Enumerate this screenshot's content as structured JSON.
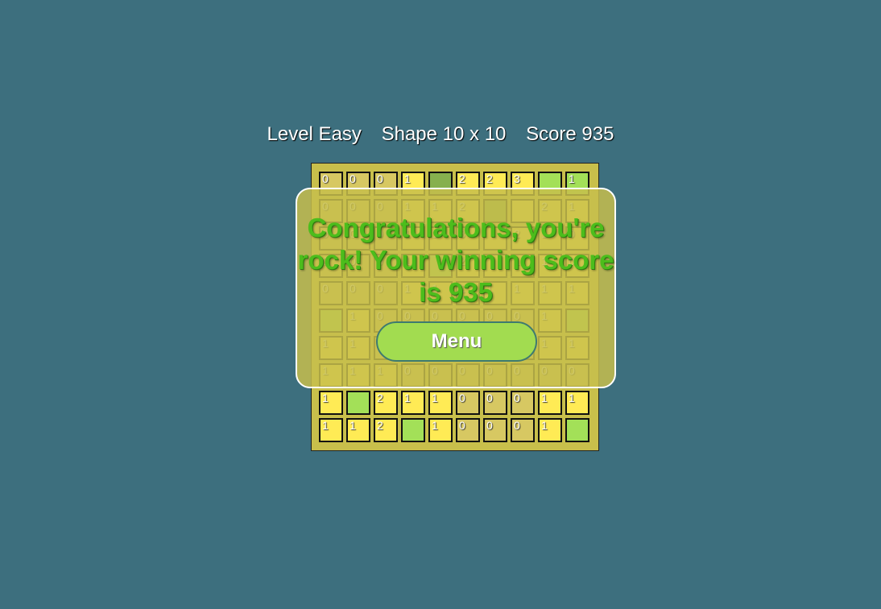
{
  "status": {
    "level": "Level Easy",
    "shape": "Shape 10 x 10",
    "score": "Score 935"
  },
  "colors": {
    "background": "#3d6f7e",
    "board": "#c8bf4b",
    "cell_yellow": "#ffeb55",
    "cell_tan": "#d7c862",
    "cell_green": "#a3e058",
    "cell_dark_green": "#86b04e",
    "message_green": "#4cbd1c"
  },
  "board": {
    "rows": 10,
    "cols": 10,
    "cells": [
      [
        [
          "t",
          "0"
        ],
        [
          "t",
          "0"
        ],
        [
          "t",
          "0"
        ],
        [
          "y",
          "1"
        ],
        [
          "d",
          ""
        ],
        [
          "y",
          "2"
        ],
        [
          "y",
          "2"
        ],
        [
          "y",
          "3"
        ],
        [
          "g",
          ""
        ],
        [
          "g",
          "1"
        ]
      ],
      [
        [
          "t",
          "0"
        ],
        [
          "t",
          "0"
        ],
        [
          "t",
          "0"
        ],
        [
          "y",
          "1"
        ],
        [
          "y",
          "1"
        ],
        [
          "y",
          "2"
        ],
        [
          "d",
          ""
        ],
        [
          "y",
          ""
        ],
        [
          "y",
          "2"
        ],
        [
          "y",
          "1"
        ]
      ],
      [
        [
          "t",
          "0"
        ],
        [
          "t",
          "0"
        ],
        [
          "t",
          "0"
        ],
        [
          "y",
          "1"
        ],
        [
          "y",
          "1"
        ],
        [
          "y",
          "3"
        ],
        [
          "y",
          ""
        ],
        [
          "y",
          "2"
        ],
        [
          "y",
          "1"
        ],
        [
          "y",
          "0"
        ]
      ],
      [
        [
          "t",
          "0"
        ],
        [
          "t",
          "0"
        ],
        [
          "t",
          "0"
        ],
        [
          "y",
          "1"
        ],
        [
          "g",
          ""
        ],
        [
          "y",
          "2"
        ],
        [
          "y",
          ""
        ],
        [
          "y",
          "1"
        ],
        [
          "y",
          "1"
        ],
        [
          "y",
          "0"
        ]
      ],
      [
        [
          "t",
          "0"
        ],
        [
          "t",
          "0"
        ],
        [
          "t",
          "0"
        ],
        [
          "y",
          "1"
        ],
        [
          "y",
          "1"
        ],
        [
          "y",
          "1"
        ],
        [
          "y",
          "1"
        ],
        [
          "y",
          "1"
        ],
        [
          "y",
          "1"
        ],
        [
          "y",
          "1"
        ]
      ],
      [
        [
          "g",
          ""
        ],
        [
          "y",
          "1"
        ],
        [
          "t",
          "0"
        ],
        [
          "t",
          "0"
        ],
        [
          "t",
          "0"
        ],
        [
          "t",
          "0"
        ],
        [
          "t",
          "0"
        ],
        [
          "t",
          "0"
        ],
        [
          "y",
          "1"
        ],
        [
          "g",
          ""
        ]
      ],
      [
        [
          "y",
          "1"
        ],
        [
          "y",
          "1"
        ],
        [
          "t",
          "0"
        ],
        [
          "t",
          "0"
        ],
        [
          "t",
          "0"
        ],
        [
          "t",
          "0"
        ],
        [
          "t",
          "0"
        ],
        [
          "t",
          "0"
        ],
        [
          "y",
          "1"
        ],
        [
          "y",
          "1"
        ]
      ],
      [
        [
          "y",
          "1"
        ],
        [
          "y",
          "1"
        ],
        [
          "y",
          "1"
        ],
        [
          "t",
          "0"
        ],
        [
          "t",
          "0"
        ],
        [
          "t",
          "0"
        ],
        [
          "t",
          "0"
        ],
        [
          "t",
          "0"
        ],
        [
          "t",
          "0"
        ],
        [
          "t",
          "0"
        ]
      ],
      [
        [
          "y",
          "1"
        ],
        [
          "g",
          ""
        ],
        [
          "y",
          "2"
        ],
        [
          "y",
          "1"
        ],
        [
          "y",
          "1"
        ],
        [
          "t",
          "0"
        ],
        [
          "t",
          "0"
        ],
        [
          "t",
          "0"
        ],
        [
          "y",
          "1"
        ],
        [
          "y",
          "1"
        ]
      ],
      [
        [
          "y",
          "1"
        ],
        [
          "y",
          "1"
        ],
        [
          "y",
          "2"
        ],
        [
          "g",
          ""
        ],
        [
          "y",
          "1"
        ],
        [
          "t",
          "0"
        ],
        [
          "t",
          "0"
        ],
        [
          "t",
          "0"
        ],
        [
          "y",
          "1"
        ],
        [
          "g",
          ""
        ]
      ]
    ]
  },
  "dialog": {
    "message": "Congratulations, you're rock! Your winning score is 935",
    "menu_label": "Menu"
  }
}
